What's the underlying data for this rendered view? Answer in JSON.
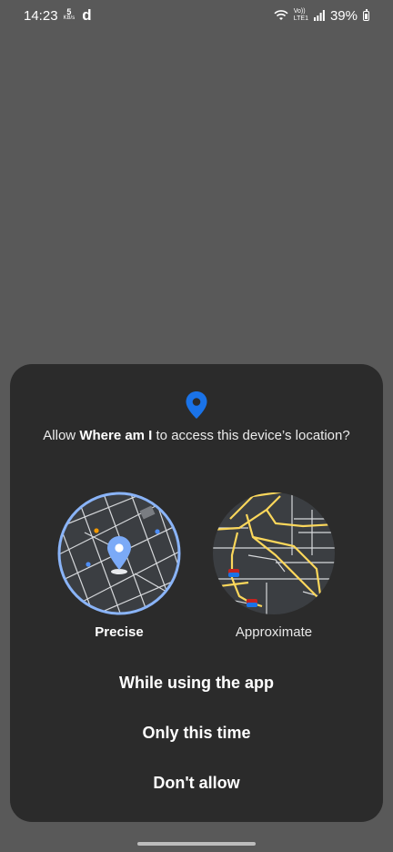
{
  "status_bar": {
    "time": "14:23",
    "data_speed_value": "5",
    "data_speed_unit": "KB/s",
    "carrier_glyph": "d",
    "volte_label": "Vo))",
    "lte_label": "LTE1",
    "battery": "39%",
    "icons": [
      "wifi-icon",
      "signal-icon",
      "battery-icon"
    ]
  },
  "dialog": {
    "icon": "location-pin-icon",
    "prompt_prefix": "Allow ",
    "app_name": "Where am I",
    "prompt_suffix": " to access this device’s location?",
    "options": [
      {
        "label": "Precise",
        "selected": true
      },
      {
        "label": "Approximate",
        "selected": false
      }
    ],
    "actions": {
      "while_using": "While using the app",
      "only_this_time": "Only this time",
      "dont_allow": "Don't allow"
    }
  },
  "colors": {
    "accent": "#1a73e8",
    "precise_ring": "#8ab4f8",
    "approx_roads": "#fbd75b",
    "sheet": "#2b2b2b",
    "scrim": "#595959"
  }
}
